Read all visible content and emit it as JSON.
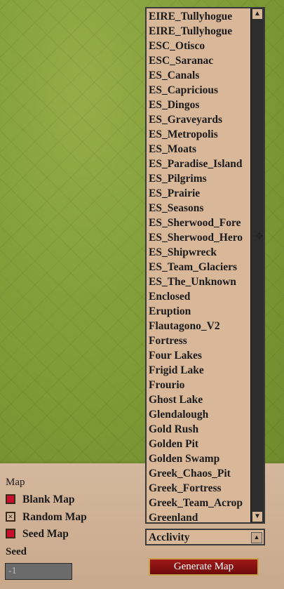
{
  "map_list": {
    "items": [
      "EIRE_Tullyhogue",
      "EIRE_Tullyhogue",
      "ESC_Otisco",
      "ESC_Saranac",
      "ES_Canals",
      "ES_Capricious",
      "ES_Dingos",
      "ES_Graveyards",
      "ES_Metropolis",
      "ES_Moats",
      "ES_Paradise_Island",
      "ES_Pilgrims",
      "ES_Prairie",
      "ES_Seasons",
      "ES_Sherwood_Fore",
      "ES_Sherwood_Hero",
      "ES_Shipwreck",
      "ES_Team_Glaciers",
      "ES_The_Unknown",
      "Enclosed",
      "Eruption",
      "Flautagono_V2",
      "Fortress",
      "Four Lakes",
      "Frigid Lake",
      "Frourio",
      "Ghost Lake",
      "Glendalough",
      "Gold Rush",
      "Golden Pit",
      "Golden Swamp",
      "Greek_Chaos_Pit",
      "Greek_Fortress",
      "Greek_Team_Acrop",
      "Greenland"
    ]
  },
  "selected_map": "Acclivity",
  "map_section": {
    "heading": "Map",
    "options": [
      {
        "label": "Blank Map",
        "state": "red"
      },
      {
        "label": "Random Map",
        "state": "x"
      },
      {
        "label": "Seed Map",
        "state": "red"
      }
    ]
  },
  "seed": {
    "label": "Seed",
    "value": "-1"
  },
  "generate_button": "Generate Map",
  "icons": {
    "scroll_up": "triangle-up-icon",
    "scroll_down": "triangle-down-icon",
    "cursor": "move-cursor-icon"
  },
  "colors": {
    "list_bg": "#d9b89a",
    "button_red": "#a01818",
    "button_border": "#c8a24a"
  }
}
